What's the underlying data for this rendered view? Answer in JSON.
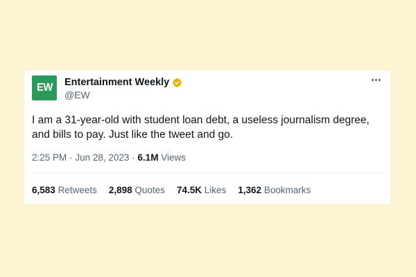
{
  "colors": {
    "page_background": "#fcf4d2",
    "card_background": "#ffffff",
    "avatar_green": "#2c9a5b",
    "verified_gold": "#e2b719",
    "text_primary": "#0f1419",
    "text_secondary": "#536471"
  },
  "author": {
    "avatar_text": "EW",
    "name": "Entertainment Weekly",
    "handle": "@EW",
    "verified_icon": "verified-badge-icon"
  },
  "more_icon": "more-options-icon",
  "tweet": {
    "text": "I am a 31-year-old with student loan debt, a useless journalism degree, and bills to pay. Just like the tweet and go.",
    "time": "2:25 PM",
    "separator": "·",
    "date": "Jun 28, 2023",
    "views_count": "6.1M",
    "views_label": "Views"
  },
  "stats": [
    {
      "count": "6,583",
      "label": "Retweets"
    },
    {
      "count": "2,898",
      "label": "Quotes"
    },
    {
      "count": "74.5K",
      "label": "Likes"
    },
    {
      "count": "1,362",
      "label": "Bookmarks"
    }
  ]
}
